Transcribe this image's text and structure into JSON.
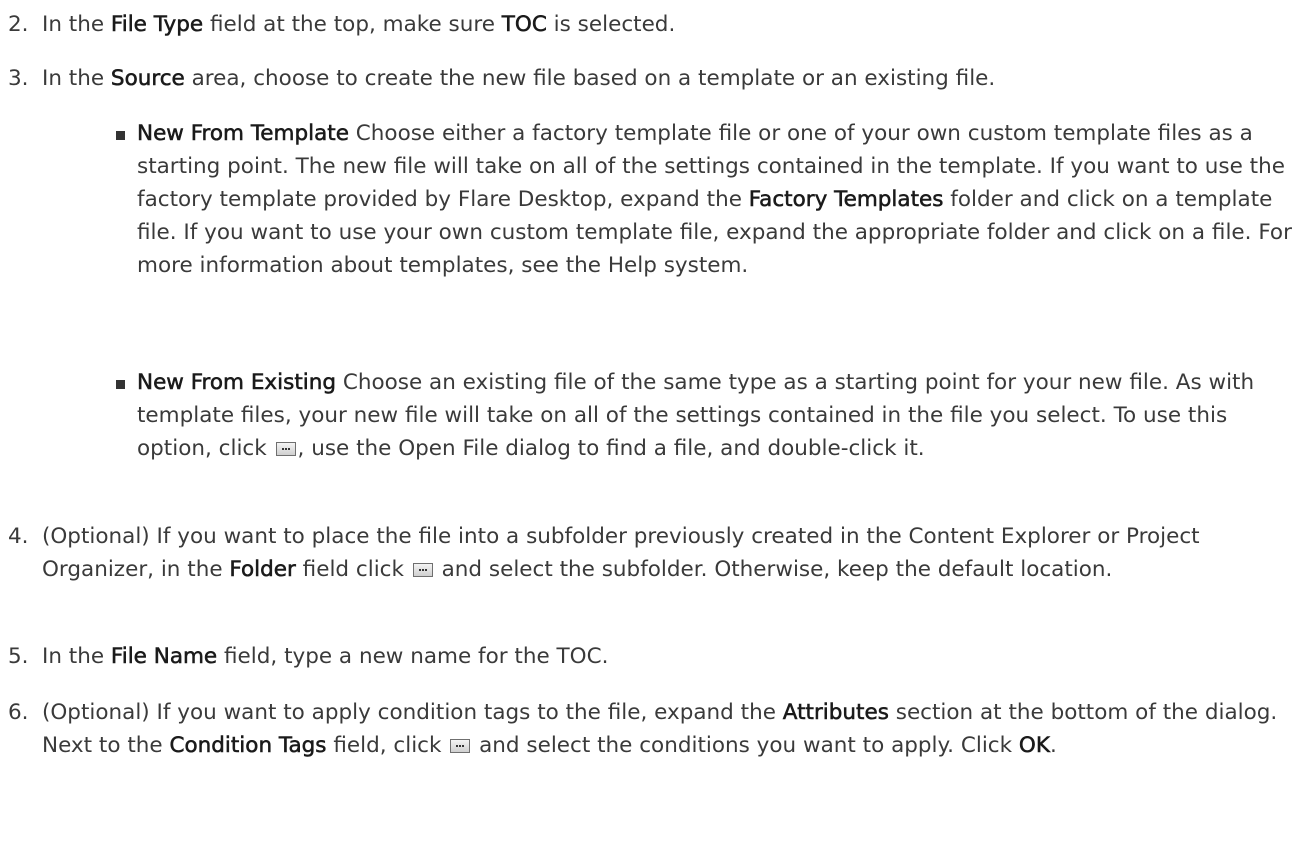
{
  "steps": [
    {
      "num": "2.",
      "parts": [
        "In the ",
        "File Type",
        " field at the top, make sure ",
        "TOC",
        " is selected."
      ]
    },
    {
      "num": "3.",
      "parts": [
        "In the ",
        "Source",
        " area, choose to create the new file based on a template or an existing file."
      ]
    },
    {
      "num": "4.",
      "parts": [
        "(Optional) If you want to place the file into a subfolder previously created in the Content Explorer or Project Organizer, in the ",
        "Folder",
        " field click ",
        " and select the subfolder. Otherwise, keep the default location."
      ]
    },
    {
      "num": "5.",
      "parts": [
        "In the ",
        "File Name",
        " field, type a new name for the TOC."
      ]
    },
    {
      "num": "6.",
      "parts": [
        "(Optional) If you want to apply condition tags to the file, expand the ",
        "Attributes",
        " section at the bottom of the dialog. Next to the ",
        "Condition Tags",
        " field, click ",
        " and select the conditions you want to apply. Click ",
        "OK",
        "."
      ]
    }
  ],
  "bullets": [
    {
      "parts": [
        "New From Template",
        " Choose either a factory template file or one of your own custom template files as a starting point. The new file will take on all of the settings contained in the template. If you want to use the factory template provided by Flare Desktop, expand the ",
        "Factory Templates",
        " folder and click on a template file. If you want to use your own custom template file, expand the appropriate folder and click on a file. For more information about templates, see the Help system."
      ]
    },
    {
      "parts": [
        "New From Existing",
        " Choose an existing file of the same type as a starting point for your new file. As with template files, your new file will take on all of the settings contained in the file you select. To use this option, click ",
        ", use the Open File dialog to find a file, and double-click it."
      ]
    }
  ],
  "icons": {
    "browse_button": "ellipsis-browse-icon"
  }
}
